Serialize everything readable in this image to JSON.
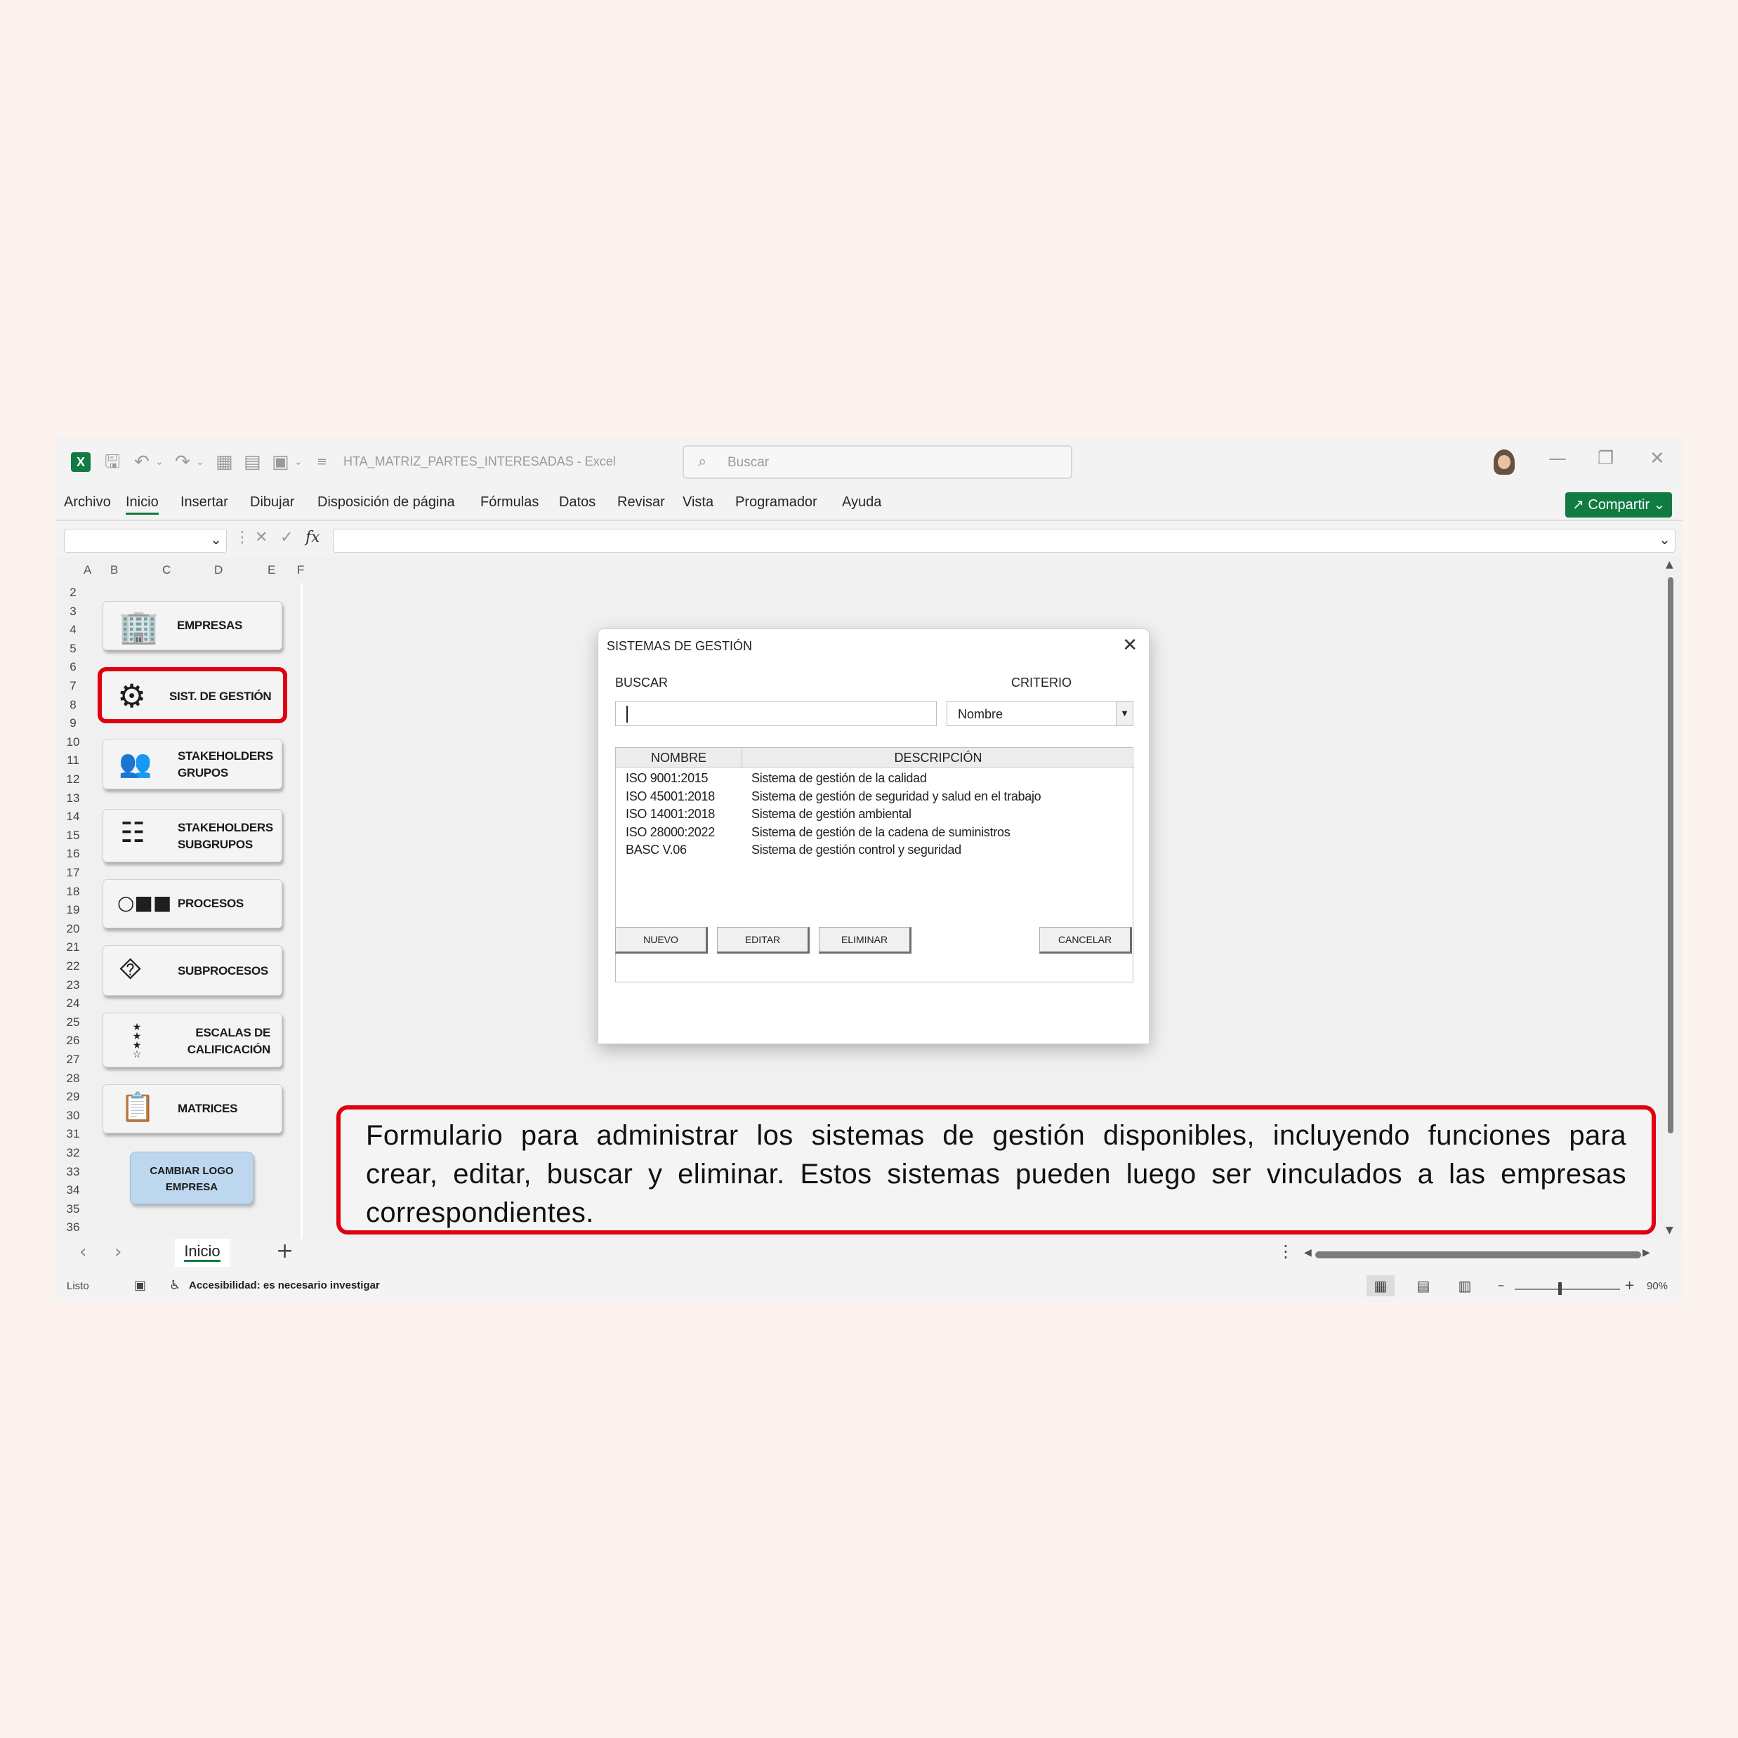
{
  "titlebar": {
    "doc_title": "HTA_MATRIZ_PARTES_INTERESADAS  -  Excel",
    "search_placeholder": "Buscar",
    "excel_logo": "X",
    "icons": [
      "excel-logo-icon",
      "autosave-icon",
      "undo-icon",
      "redo-icon",
      "table-icon",
      "form-icon",
      "paste-icon",
      "customize-icon",
      "search-icon",
      "avatar",
      "minimize-icon",
      "restore-icon",
      "close-icon"
    ]
  },
  "menu": {
    "items": [
      "Archivo",
      "Inicio",
      "Insertar",
      "Dibujar",
      "Disposición de página",
      "Fórmulas",
      "Datos",
      "Revisar",
      "Vista",
      "Programador",
      "Ayuda"
    ],
    "active": "Inicio",
    "share_label": "Compartir"
  },
  "formula_bar": {
    "fx": "fx"
  },
  "grid": {
    "columns": [
      "A",
      "B",
      "C",
      "D",
      "E",
      "F"
    ],
    "rows": [
      "2",
      "3",
      "4",
      "5",
      "6",
      "7",
      "8",
      "9",
      "10",
      "11",
      "12",
      "13",
      "14",
      "15",
      "16",
      "17",
      "18",
      "19",
      "20",
      "21",
      "22",
      "23",
      "24",
      "25",
      "26",
      "27",
      "28",
      "29",
      "30",
      "31",
      "32",
      "33",
      "34",
      "35",
      "36"
    ]
  },
  "sidebar": {
    "buttons": [
      {
        "line1": "EMPRESAS",
        "line2": "",
        "icon": "building-icon"
      },
      {
        "line1": "SIST. DE GESTIÓN",
        "line2": "",
        "icon": "gears-icon"
      },
      {
        "line1": "STAKEHOLDERS",
        "line2": "GRUPOS",
        "icon": "users-group-icon"
      },
      {
        "line1": "STAKEHOLDERS",
        "line2": "SUBGRUPOS",
        "icon": "hierarchy-users-icon"
      },
      {
        "line1": "PROCESOS",
        "line2": "",
        "icon": "process-flow-icon"
      },
      {
        "line1": "SUBPROCESOS",
        "line2": "",
        "icon": "org-chart-icon"
      },
      {
        "line1": "ESCALAS DE",
        "line2": "CALIFICACIÓN",
        "icon": "stars-rating-icon"
      },
      {
        "line1": "MATRICES",
        "line2": "",
        "icon": "matrix-document-icon"
      }
    ],
    "logo_button": {
      "line1": "CAMBIAR LOGO",
      "line2": "EMPRESA"
    }
  },
  "dialog": {
    "title": "SISTEMAS DE GESTIÓN",
    "buscar_label": "BUSCAR",
    "buscar_value": "",
    "criterio_label": "CRITERIO",
    "criterio_value": "Nombre",
    "columns": [
      "NOMBRE",
      "DESCRIPCIÓN"
    ],
    "rows": [
      {
        "nombre": "ISO 9001:2015",
        "descripcion": "Sistema de gestión de la calidad"
      },
      {
        "nombre": "ISO 45001:2018",
        "descripcion": "Sistema de gestión de seguridad y salud en el trabajo"
      },
      {
        "nombre": "ISO 14001:2018",
        "descripcion": "Sistema de gestión ambiental"
      },
      {
        "nombre": "ISO 28000:2022",
        "descripcion": "Sistema de gestión de la cadena de suministros"
      },
      {
        "nombre": "BASC V.06",
        "descripcion": "Sistema de gestión control y seguridad"
      }
    ],
    "buttons": {
      "nuevo": "NUEVO",
      "editar": "EDITAR",
      "eliminar": "ELIMINAR",
      "cancelar": "CANCELAR"
    }
  },
  "annotation": {
    "text": "Formulario para administrar los sistemas de gestión disponibles, incluyendo funciones para crear, editar, buscar y eliminar. Estos sistemas pueden luego ser vinculados a las empresas correspondientes."
  },
  "sheet_tabs": {
    "tabs": [
      "Inicio"
    ],
    "add": "+"
  },
  "status": {
    "ready": "Listo",
    "accessibility": "Accesibilidad: es necesario investigar",
    "zoom": "90%"
  },
  "colors": {
    "excel_green": "#107c41",
    "highlight_red": "#e0000f",
    "logo_button_blue": "#bdd7ee",
    "page_background": "#fcf2ee"
  }
}
